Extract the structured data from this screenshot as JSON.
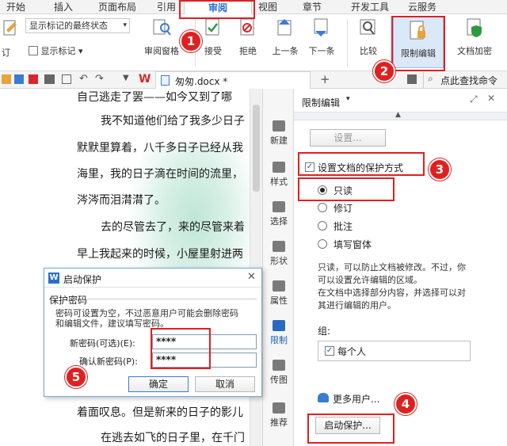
{
  "menubar": {
    "tabs": [
      "开始",
      "插入",
      "页面布局",
      "引用",
      "审阅",
      "视图",
      "章节",
      "开发工具",
      "云服务"
    ]
  },
  "ribbon": {
    "markup_dropdown": "显示标记的最终状态",
    "track_changes": "订",
    "show_markup": "显示标记",
    "review_pane": "审阅窗格",
    "accept": "接受",
    "reject": "拒绝",
    "prev": "上一条",
    "next": "下一条",
    "compare": "比较",
    "restrict_edit": "限制编辑",
    "doc_encrypt": "文档加密"
  },
  "qabar": {
    "file_name": "匆匆.docx *",
    "add_tab": "+",
    "search": "点此查找命令"
  },
  "document": {
    "lines": [
      "自己逃走了罢——如今又到了哪",
      "我不知道他们给了我多少日子",
      "默默里算着，八千多日子已经从我",
      "海里，我的日子滴在时间的流里，",
      "涔涔而泪潸潸了。",
      "去的尽管去了，来的尽管来着",
      "早上我起来的时候，小屋里射进两",
      "着面叹息。但是新来的日子的影儿",
      "在逃去如飞的日子里，在千门"
    ]
  },
  "sidetools": [
    "新建",
    "样式",
    "选择",
    "形状",
    "属性",
    "限制",
    "传图",
    "推荐"
  ],
  "panel": {
    "title": "限制编辑",
    "settings_button": "设置...",
    "protect_label": "设置文档的保护方式",
    "options": [
      "只读",
      "修订",
      "批注",
      "填写窗体"
    ],
    "selected_option": "只读",
    "description": [
      "只读，可以防止文档被修改。不过，你",
      "可以设置允许编辑的区域。",
      "在文档中选择部分内容，并选择可以对",
      "其进行编辑的用户。"
    ],
    "group_label": "组:",
    "group_item": "每个人",
    "more_users": "更多用户...",
    "start_protect_button": "启动保护..."
  },
  "dialog": {
    "title": "启动保护",
    "section": "保护密码",
    "hint": [
      "密码可设置为空，不过恶意用户可能会删除密码",
      "和编辑文件，建议填写密码。"
    ],
    "new_password_label": "新密码(可选)(E):",
    "new_password_value": "****",
    "confirm_password_label": "确认新密码(P):",
    "confirm_password_value": "****",
    "ok": "确定",
    "cancel": "取消"
  },
  "annotations": [
    "1",
    "2",
    "3",
    "4",
    "5"
  ],
  "colors": {
    "accent_red": "#e02020",
    "active_tab_blue": "#2a6fc9",
    "wps_red": "#d9252b"
  }
}
